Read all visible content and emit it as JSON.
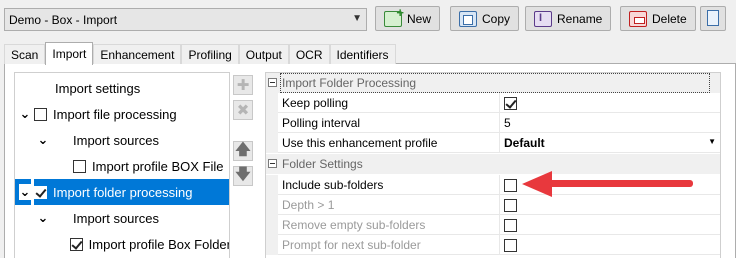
{
  "profile": {
    "value": "Demo - Box - Import"
  },
  "toolbar": {
    "new_label": "New",
    "copy_label": "Copy",
    "rename_label": "Rename",
    "delete_label": "Delete"
  },
  "tabs": [
    {
      "label": "Scan"
    },
    {
      "label": "Import"
    },
    {
      "label": "Enhancement"
    },
    {
      "label": "Profiling"
    },
    {
      "label": "Output"
    },
    {
      "label": "OCR"
    },
    {
      "label": "Identifiers"
    }
  ],
  "tree": {
    "items": [
      {
        "label": "Import settings"
      },
      {
        "label": "Import file processing",
        "checked": false
      },
      {
        "label": "Import sources"
      },
      {
        "label": "Import profile BOX File",
        "checked": false
      },
      {
        "label": "Import folder processing",
        "checked": true,
        "selected": true
      },
      {
        "label": "Import sources"
      },
      {
        "label": "Import profile Box Folder",
        "checked": true
      }
    ]
  },
  "grid": {
    "category1": "Import Folder Processing",
    "keep_polling": {
      "name": "Keep polling",
      "checked": true
    },
    "polling_interval": {
      "name": "Polling interval",
      "value": "5"
    },
    "enhancement_profile": {
      "name": "Use this enhancement profile",
      "value": "Default"
    },
    "category2": "Folder Settings",
    "include_subfolders": {
      "name": "Include sub-folders",
      "checked": false
    },
    "depth": {
      "name": "Depth > 1",
      "checked": false
    },
    "remove_empty": {
      "name": "Remove empty sub-folders",
      "checked": false
    },
    "prompt_next": {
      "name": "Prompt for next sub-folder",
      "checked": false
    }
  },
  "colors": {
    "selection": "#0078d7",
    "annotation_arrow": "#e8383d"
  }
}
